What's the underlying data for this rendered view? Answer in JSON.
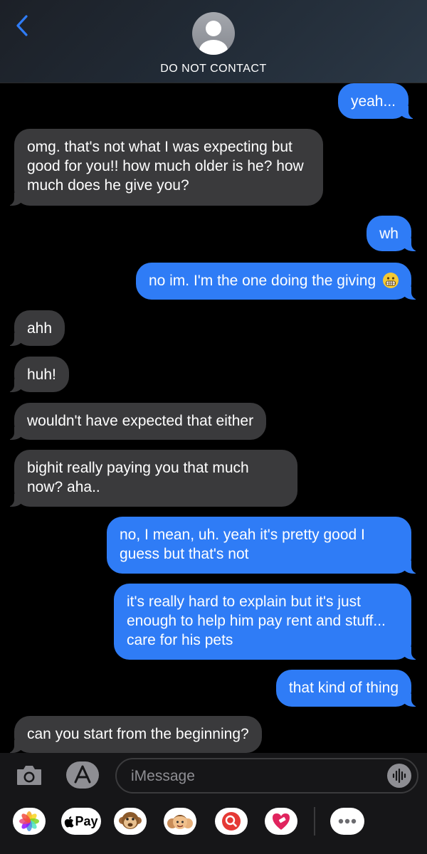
{
  "header": {
    "contact_name": "DO NOT CONTACT"
  },
  "messages": [
    {
      "from": "me",
      "text": "yeah..."
    },
    {
      "from": "them",
      "text": "omg.  that's not what I was expecting but good for you!! how much older is he? how much does he give you?"
    },
    {
      "from": "me",
      "text": "wh"
    },
    {
      "from": "me",
      "text": "no im. I'm the one doing the giving",
      "emoji": "grimacing-face"
    },
    {
      "from": "them",
      "text": "ahh"
    },
    {
      "from": "them",
      "text": "huh!"
    },
    {
      "from": "them",
      "text": "wouldn't have expected that either"
    },
    {
      "from": "them",
      "text": "bighit really paying you that much now? aha.."
    },
    {
      "from": "me",
      "text": "no, I mean, uh. yeah it's pretty good I guess but that's not"
    },
    {
      "from": "me",
      "text": "it's really hard to explain but it's just enough to help him pay rent and stuff... care for his pets"
    },
    {
      "from": "me",
      "text": "that kind of thing"
    },
    {
      "from": "them",
      "text": "can you start from the beginning?"
    }
  ],
  "composer": {
    "placeholder": "iMessage"
  },
  "app_drawer": {
    "apple_pay_label": "Pay",
    "apps": [
      "photos-icon",
      "apple-pay-icon",
      "monkey-animoji-icon",
      "memoji-icon",
      "image-search-icon",
      "heart-sticker-icon",
      "more-icon"
    ]
  },
  "colors": {
    "outgoing": "#2f7cf6",
    "incoming": "#3a3a3c",
    "background": "#000000"
  }
}
